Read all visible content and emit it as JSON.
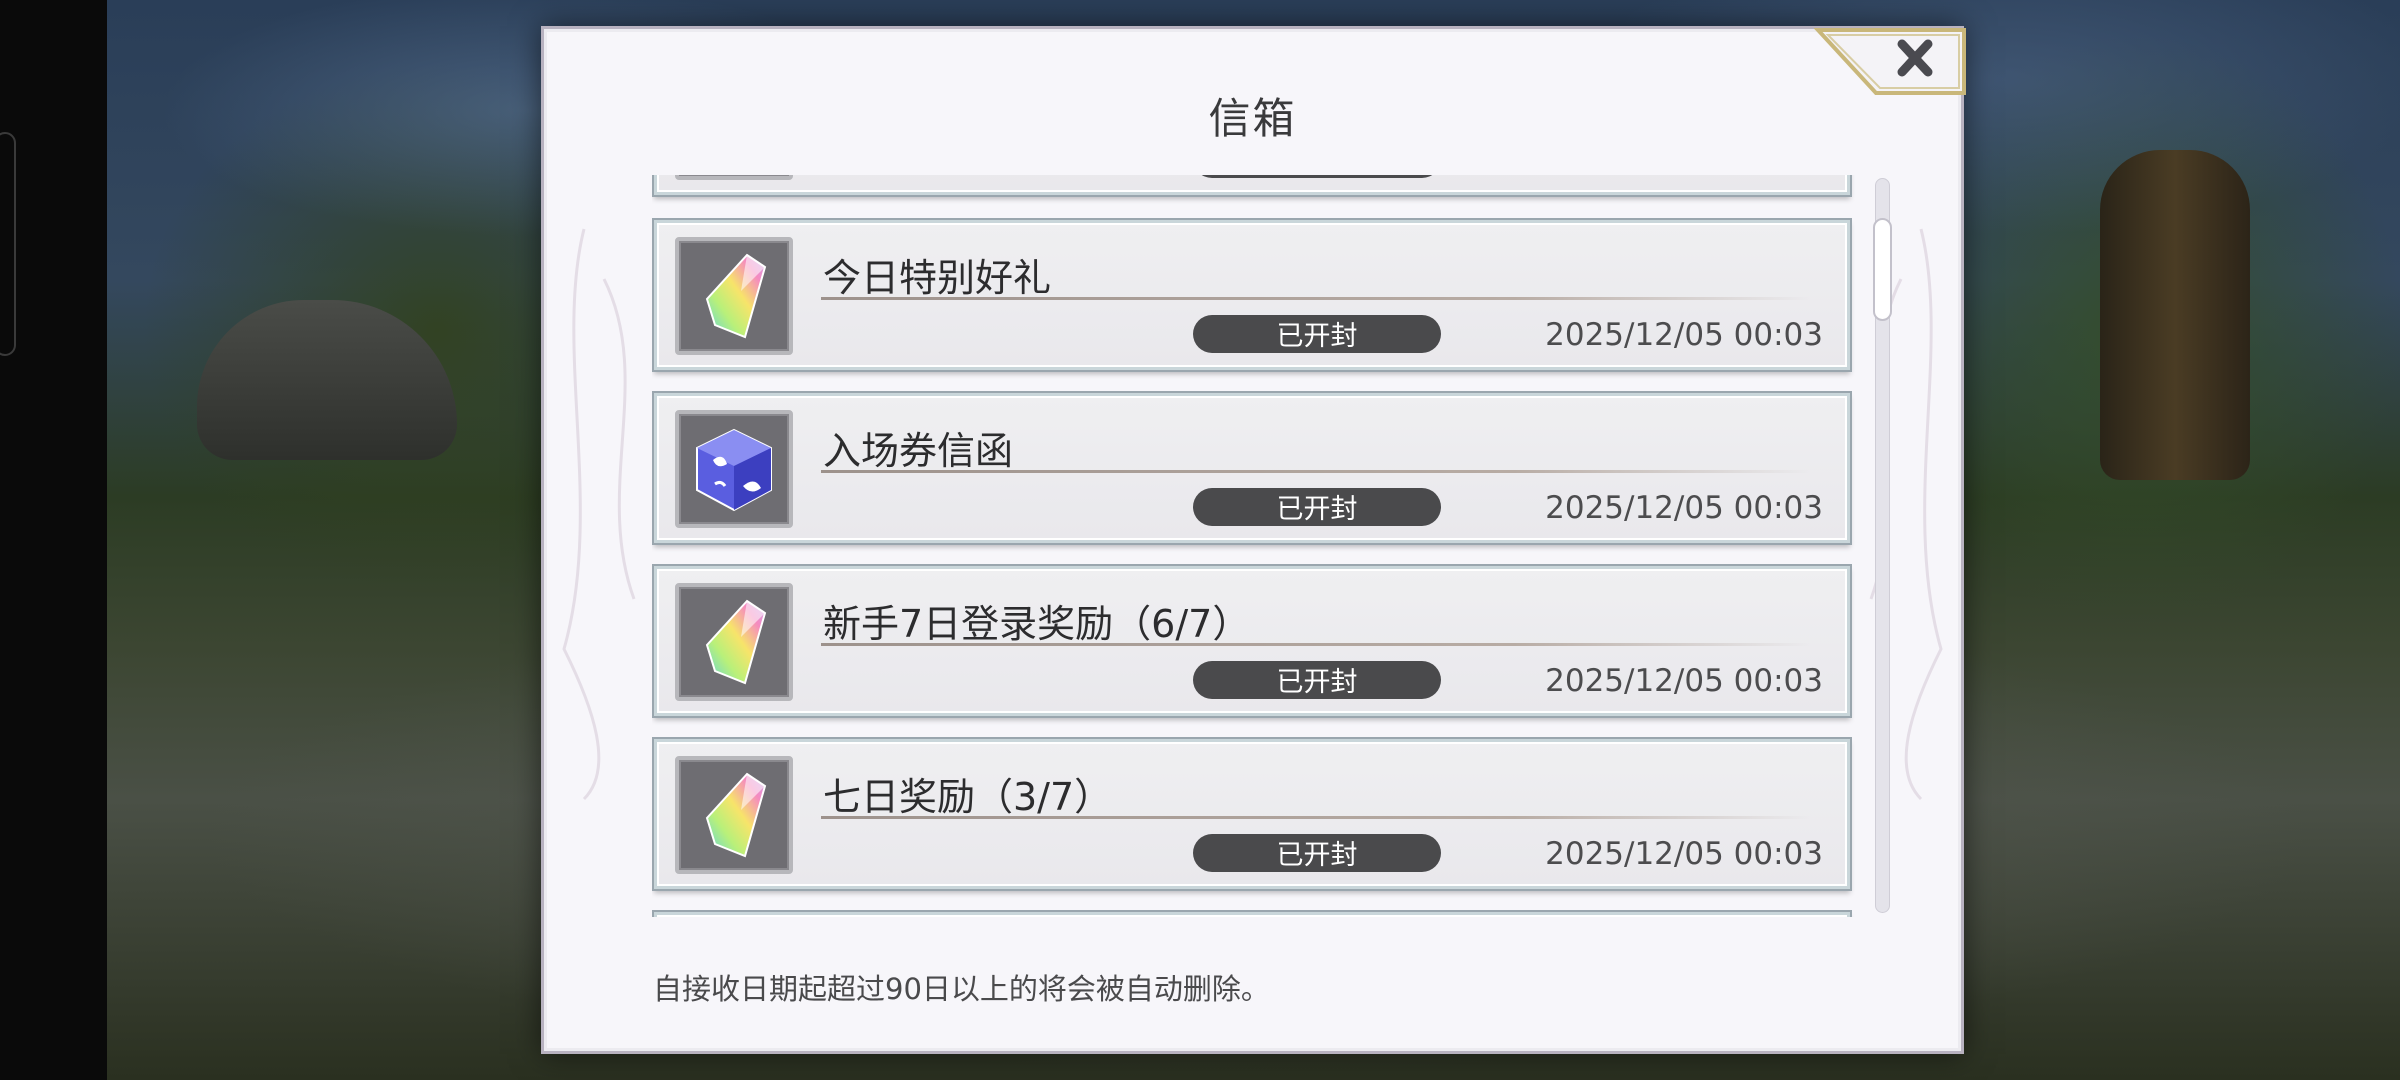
{
  "dialog": {
    "title": "信箱",
    "close_label": "✕",
    "footer_note": "自接收日期起超过90日以上的将会被自动删除。"
  },
  "mails": [
    {
      "title": "今日特别好礼",
      "status": "已开封",
      "date": "2025/12/05 00:03",
      "icon": "rainbow-crystal-icon"
    },
    {
      "title": "入场券信函",
      "status": "已开封",
      "date": "2025/12/05 00:03",
      "icon": "blue-ticket-cube-icon"
    },
    {
      "title": "新手7日登录奖励（6/7）",
      "status": "已开封",
      "date": "2025/12/05 00:03",
      "icon": "rainbow-crystal-icon"
    },
    {
      "title": "七日奖励（3/7）",
      "status": "已开封",
      "date": "2025/12/05 00:03",
      "icon": "rainbow-crystal-icon"
    }
  ],
  "colors": {
    "dialog_bg": "#f7f6fa",
    "badge_bg": "#4a4a4c",
    "close_gold": "#c9b77a"
  }
}
